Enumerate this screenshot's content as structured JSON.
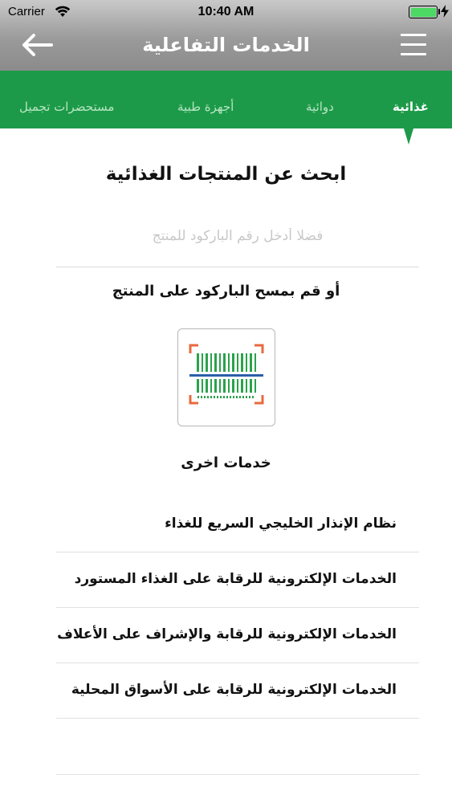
{
  "status_bar": {
    "carrier": "Carrier",
    "time": "10:40 AM",
    "battery_level": 1.0,
    "battery_color": "#4cd964"
  },
  "header": {
    "title": "الخدمات التفاعلية",
    "back_icon": "arrow-left-icon",
    "menu_icon": "hamburger-menu-icon",
    "background_color": "#9a9a9a"
  },
  "tabs": {
    "accent_color": "#1d9a49",
    "items": [
      {
        "label": "غذائية",
        "active": true
      },
      {
        "label": "دوائية",
        "active": false
      },
      {
        "label": "أجهزة طبية",
        "active": false
      },
      {
        "label": "مستحضرات تجميل",
        "active": false
      }
    ]
  },
  "search": {
    "heading": "ابحث عن المنتجات الغذائية",
    "input_value": "",
    "input_placeholder": "فضلا أدخل رقم الباركود للمنتج",
    "scan_label": "أو قم بمسح الباركود على المنتج",
    "scan_icon": "barcode-scanner-icon"
  },
  "other_services": {
    "heading": "خدمات اخرى",
    "items": [
      {
        "label": "نظام الإنذار الخليجي السريع للغذاء"
      },
      {
        "label": "الخدمات الإلكترونية للرقابة على الغذاء المستورد"
      },
      {
        "label": "الخدمات الإلكترونية للرقابة والإشراف على الأعلاف"
      },
      {
        "label": "الخدمات الإلكترونية للرقابة على الأسواق المحلية"
      }
    ]
  }
}
